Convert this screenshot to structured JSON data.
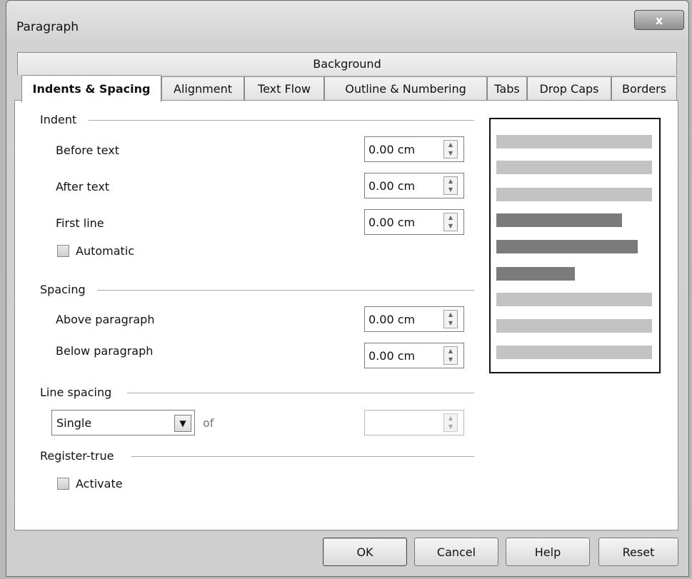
{
  "window": {
    "title": "Paragraph",
    "close_glyph": "x"
  },
  "tabs": {
    "row1": [
      {
        "label": "Background",
        "active": false
      }
    ],
    "row2": [
      {
        "label": "Indents & Spacing",
        "active": true
      },
      {
        "label": "Alignment",
        "active": false
      },
      {
        "label": "Text Flow",
        "active": false
      },
      {
        "label": "Outline & Numbering",
        "active": false
      },
      {
        "label": "Tabs",
        "active": false
      },
      {
        "label": "Drop Caps",
        "active": false
      },
      {
        "label": "Borders",
        "active": false
      }
    ]
  },
  "indent": {
    "section_label": "Indent",
    "before_text": {
      "label": "Before text",
      "value": "0.00 cm"
    },
    "after_text": {
      "label": "After text",
      "value": "0.00 cm"
    },
    "first_line": {
      "label": "First line",
      "value": "0.00 cm"
    },
    "automatic": {
      "label": "Automatic",
      "checked": false
    }
  },
  "spacing": {
    "section_label": "Spacing",
    "above": {
      "label": "Above paragraph",
      "value": "0.00 cm"
    },
    "below": {
      "label": "Below paragraph",
      "value": "0.00 cm"
    }
  },
  "line_spacing": {
    "section_label": "Line spacing",
    "selected": "Single",
    "of_label": "of",
    "of_value": ""
  },
  "register_true": {
    "section_label": "Register-true",
    "activate": {
      "label": "Activate",
      "checked": false
    }
  },
  "preview": {
    "bar_colors": {
      "context": "#c3c3c3",
      "current": "#7b7b7b"
    }
  },
  "buttons": {
    "ok": "OK",
    "cancel": "Cancel",
    "help": "Help",
    "reset": "Reset"
  },
  "icons": {
    "close": "close-icon",
    "spin": "spin-arrows-icon",
    "dropdown": "chevron-down-icon",
    "checkbox": "checkbox-icon"
  }
}
